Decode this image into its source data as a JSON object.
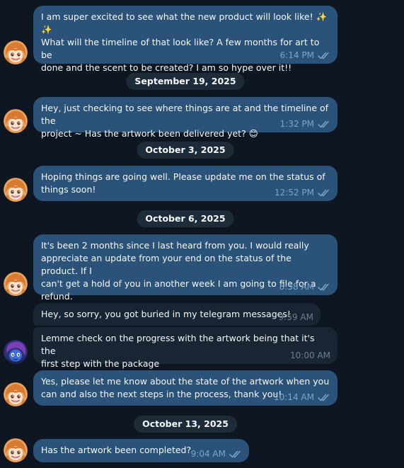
{
  "colors": {
    "background": "#0e1621",
    "outgoing_bubble": "#2b5278",
    "incoming_bubble": "#182533",
    "time_out": "#7ea4c7",
    "time_in": "#6d7f8f",
    "date_pill": "#1e2c3a"
  },
  "messages": [
    {
      "text": "I am super excited to see what the new product will look like! ✨ ✨\nWhat will the timeline of that look like? A few months for art to be\ndone and the scent to be created? I am so hype over it!!",
      "time": "6:14 PM",
      "read_icon": "double-check-icon"
    },
    {
      "text": "Hey, just checking to see where things are at and the timeline of the\nproject ~ Has the artwork been delivered yet? 😊",
      "time": "1:32 PM",
      "read_icon": "double-check-icon"
    },
    {
      "text": "Hoping things are going well. Please update me on the status of\nthings soon!",
      "time": "12:52 PM",
      "read_icon": "double-check-icon"
    },
    {
      "text": "It's been 2 months since I last heard from you. I would really\nappreciate an update from your end on the status of the product. If I\ncan't get a hold of you in another week I am going to file for a\nrefund.",
      "time": "8:58 AM",
      "read_icon": "double-check-icon"
    },
    {
      "text": "Hey, so sorry, you got buried in my telegram messages!",
      "time": "9:59 AM"
    },
    {
      "text": "Lemme check on the progress with the artwork being that it's the\nfirst step with the package",
      "time": "10:00 AM"
    },
    {
      "text": "Yes, please let me know about the state of the artwork when you\ncan and also the next steps in the process, thank you!",
      "time": "10:14 AM",
      "read_icon": "double-check-icon"
    },
    {
      "text": "Has the artwork been completed?",
      "time": "9:04 AM",
      "read_icon": "double-check-icon"
    }
  ],
  "dates": [
    "September 19, 2025",
    "October 3, 2025",
    "October 6, 2025",
    "October 13, 2025"
  ],
  "avatars": {
    "me": "anime-girl-avatar-icon",
    "seller": "purple-haired-avatar-icon"
  }
}
